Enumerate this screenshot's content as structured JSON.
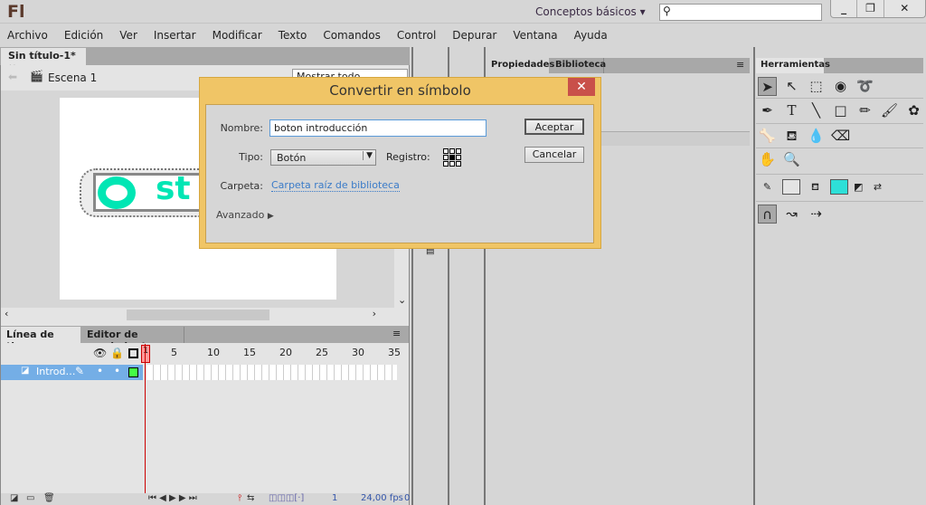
{
  "app": {
    "logo": "Fl",
    "workspace": "Conceptos básicos",
    "search_placeholder": "",
    "window_buttons": [
      "_",
      "❐",
      "✕"
    ]
  },
  "menu": [
    "Archivo",
    "Edición",
    "Ver",
    "Insertar",
    "Modificar",
    "Texto",
    "Comandos",
    "Control",
    "Depurar",
    "Ventana",
    "Ayuda"
  ],
  "document": {
    "tab": "Sin título-1*",
    "close": "×",
    "scene": "Escena 1",
    "zoom": "Mostrar todo",
    "stage_text": "st"
  },
  "timeline": {
    "tabs": [
      "Línea de tiempo",
      "Editor de movimiento"
    ],
    "frame_numbers": [
      "1",
      "5",
      "10",
      "15",
      "20",
      "25",
      "30",
      "35"
    ],
    "layer_name": "Introd…",
    "current_frame": "1",
    "fps": "24,00 fps",
    "elapsed": "0"
  },
  "panels": {
    "properties_tab": "Propiedades",
    "library_tab": "Biblioteca",
    "tools_tab": "Herramientas"
  },
  "dialog": {
    "title": "Convertir en símbolo",
    "close": "✕",
    "name_label": "Nombre:",
    "name_value": "boton introducción",
    "type_label": "Tipo:",
    "type_value": "Botón",
    "registration_label": "Registro:",
    "folder_label": "Carpeta:",
    "folder_value": "Carpeta raíz de biblioteca",
    "advanced": "Avanzado",
    "ok": "Aceptar",
    "cancel": "Cancelar"
  },
  "colors": {
    "fill": "#2ee0d8",
    "stroke": "#e4e4e4",
    "dialog": "#f0c566",
    "selection": "#74aee6",
    "accent_art": "#00e6b4"
  }
}
